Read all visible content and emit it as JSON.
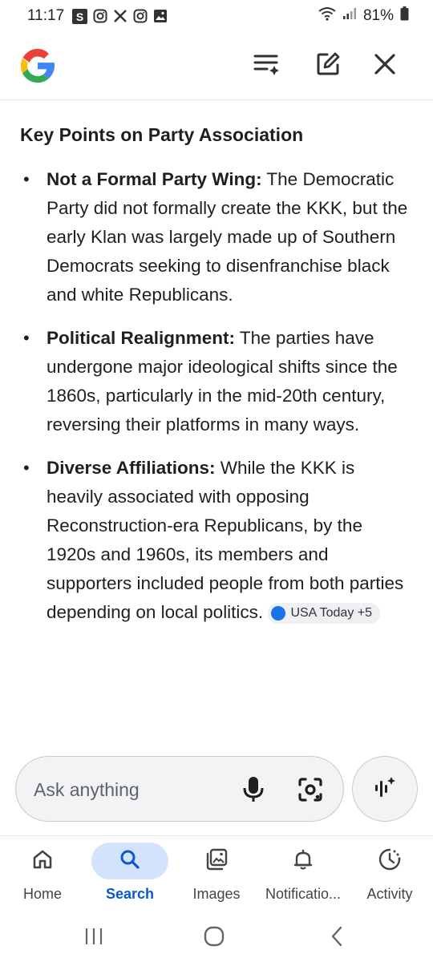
{
  "status_bar": {
    "time": "11:17",
    "battery": "81%",
    "notification_icons": [
      "s-app-icon",
      "instagram-icon",
      "x-icon",
      "instagram-icon",
      "gallery-icon"
    ]
  },
  "header": {
    "logo": "google-g-logo",
    "actions": [
      "history-icon",
      "edit-icon",
      "close-icon"
    ]
  },
  "content": {
    "heading": "Key Points on Party Association",
    "points": [
      {
        "term": "Not a Formal Party Wing:",
        "text": " The Democratic Party did not formally create the KKK, but the early Klan was largely made up of Southern Democrats seeking to disenfranchise black and white Republicans."
      },
      {
        "term": "Political Realignment:",
        "text": " The parties have undergone major ideological shifts since the 1860s, particularly in the mid-20th century, reversing their platforms in many ways."
      },
      {
        "term": "Diverse Affiliations:",
        "text": " While the KKK is heavily associated with opposing Reconstruction-era Republicans, by the 1920s and 1960s, its members and supporters included people from both parties depending on local politics.",
        "source_chip": "USA Today +5"
      }
    ]
  },
  "ask_bar": {
    "placeholder": "Ask anything"
  },
  "bottom_nav": {
    "items": [
      {
        "label": "Home",
        "icon": "home-icon",
        "active": false
      },
      {
        "label": "Search",
        "icon": "search-icon",
        "active": true
      },
      {
        "label": "Images",
        "icon": "images-icon",
        "active": false
      },
      {
        "label": "Notificatio...",
        "icon": "bell-icon",
        "active": false
      },
      {
        "label": "Activity",
        "icon": "activity-icon",
        "active": false
      }
    ]
  },
  "colors": {
    "accent": "#0b57d0",
    "active_pill": "#d3e3fd",
    "google_blue": "#4285f4",
    "google_red": "#ea4335",
    "google_yellow": "#fbbc05",
    "google_green": "#34a853"
  }
}
